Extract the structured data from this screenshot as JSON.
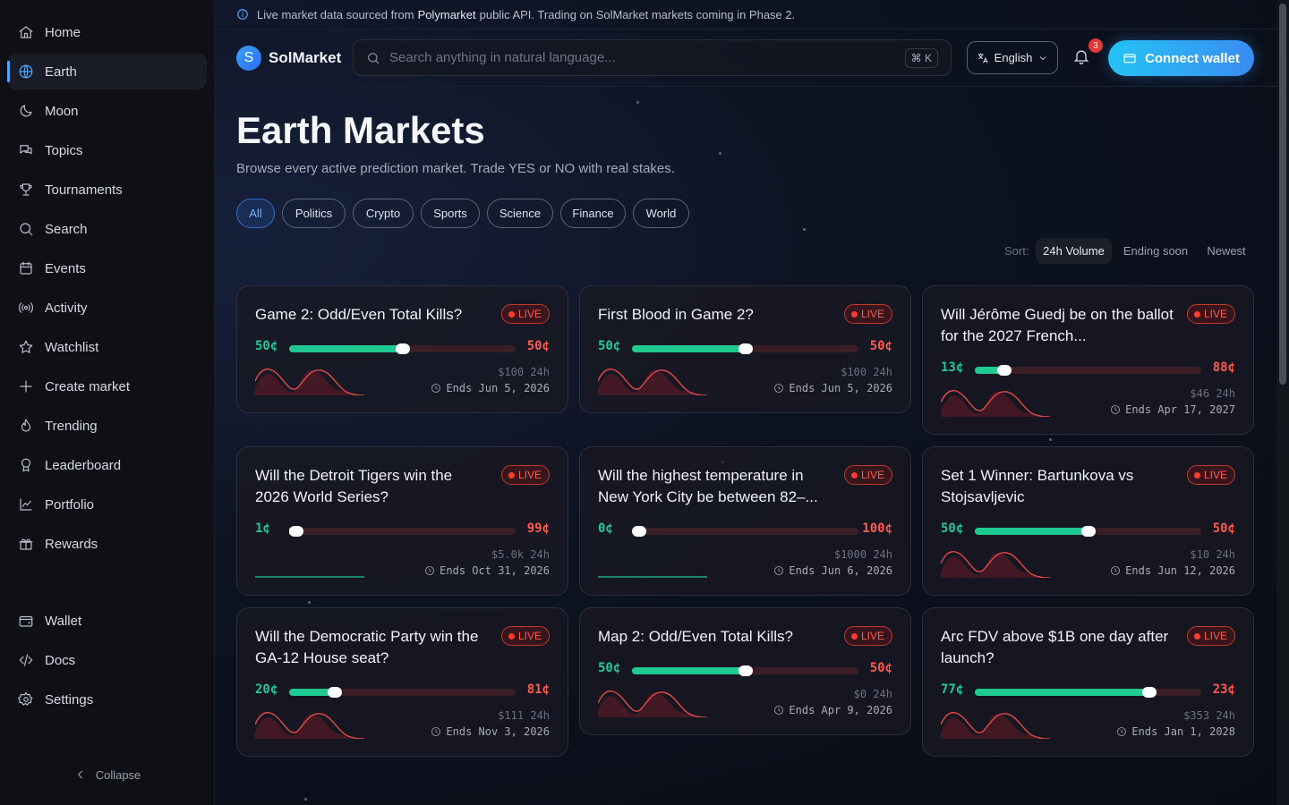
{
  "sidebar": {
    "items": [
      {
        "label": "Home",
        "icon": "home-icon"
      },
      {
        "label": "Earth",
        "icon": "globe-icon",
        "active": true
      },
      {
        "label": "Moon",
        "icon": "moon-icon"
      },
      {
        "label": "Topics",
        "icon": "chat-icon"
      },
      {
        "label": "Tournaments",
        "icon": "trophy-icon"
      },
      {
        "label": "Search",
        "icon": "search-icon"
      },
      {
        "label": "Events",
        "icon": "calendar-icon"
      },
      {
        "label": "Activity",
        "icon": "broadcast-icon"
      },
      {
        "label": "Watchlist",
        "icon": "star-icon"
      },
      {
        "label": "Create market",
        "icon": "plus-icon"
      },
      {
        "label": "Trending",
        "icon": "flame-icon"
      },
      {
        "label": "Leaderboard",
        "icon": "medal-icon"
      },
      {
        "label": "Portfolio",
        "icon": "chart-line-icon"
      },
      {
        "label": "Rewards",
        "icon": "gift-icon"
      }
    ],
    "bottom_items": [
      {
        "label": "Wallet",
        "icon": "wallet-icon"
      },
      {
        "label": "Docs",
        "icon": "code-icon"
      },
      {
        "label": "Settings",
        "icon": "gear-icon"
      }
    ],
    "collapse_label": "Collapse"
  },
  "banner": {
    "prefix": "Live market data sourced from",
    "source": "Polymarket",
    "suffix": "public API. Trading on SolMarket markets coming in Phase 2."
  },
  "header": {
    "logo_letter": "S",
    "brand": "SolMarket",
    "search_placeholder": "Search anything in natural language...",
    "search_shortcut": "⌘ K",
    "language": "English",
    "notification_count": "3",
    "connect_label": "Connect wallet"
  },
  "page": {
    "title": "Earth Markets",
    "subtitle": "Browse every active prediction market. Trade YES or NO with real stakes."
  },
  "filters": [
    "All",
    "Politics",
    "Crypto",
    "Sports",
    "Science",
    "Finance",
    "World"
  ],
  "active_filter": "All",
  "sort": {
    "label": "Sort:",
    "options": [
      "24h Volume",
      "Ending soon",
      "Newest"
    ],
    "active": "24h Volume"
  },
  "colors": {
    "accent": "#4aa8ff",
    "yes": "#22c99a",
    "no": "#ff5a4f",
    "live": "#ff3b30"
  },
  "markets": [
    {
      "title": "Game 2: Odd/Even Total Kills?",
      "badge": "LIVE",
      "yes": "50¢",
      "no": "50¢",
      "yes_fraction": 0.5,
      "volume": "$100 24h",
      "ends": "Ends Jun 5, 2026",
      "trend": "red"
    },
    {
      "title": "First Blood in Game 2?",
      "badge": "LIVE",
      "yes": "50¢",
      "no": "50¢",
      "yes_fraction": 0.5,
      "volume": "$100 24h",
      "ends": "Ends Jun 5, 2026",
      "trend": "red"
    },
    {
      "title": "Will Jérôme Guedj be on the ballot for the 2027 French...",
      "badge": "LIVE",
      "yes": "13¢",
      "no": "88¢",
      "yes_fraction": 0.13,
      "volume": "$46 24h",
      "ends": "Ends Apr 17, 2027",
      "trend": "red"
    },
    {
      "title": "Will the Detroit Tigers win the 2026 World Series?",
      "badge": "LIVE",
      "yes": "1¢",
      "no": "99¢",
      "yes_fraction": 0.01,
      "volume": "$5.0k 24h",
      "ends": "Ends Oct 31, 2026",
      "trend": "flat"
    },
    {
      "title": "Will the highest temperature in New York City be between 82–...",
      "badge": "LIVE",
      "yes": "0¢",
      "no": "100¢",
      "yes_fraction": 0.0,
      "volume": "$1000 24h",
      "ends": "Ends Jun 6, 2026",
      "trend": "flat"
    },
    {
      "title": "Set 1 Winner: Bartunkova vs Stojsavljevic",
      "badge": "LIVE",
      "yes": "50¢",
      "no": "50¢",
      "yes_fraction": 0.5,
      "volume": "$10 24h",
      "ends": "Ends Jun 12, 2026",
      "trend": "red"
    },
    {
      "title": "Will the Democratic Party win the GA-12 House seat?",
      "badge": "LIVE",
      "yes": "20¢",
      "no": "81¢",
      "yes_fraction": 0.2,
      "volume": "$111 24h",
      "ends": "Ends Nov 3, 2026",
      "trend": "red"
    },
    {
      "title": "Map 2: Odd/Even Total Kills?",
      "badge": "LIVE",
      "yes": "50¢",
      "no": "50¢",
      "yes_fraction": 0.5,
      "volume": "$0 24h",
      "ends": "Ends Apr 9, 2026",
      "trend": "red"
    },
    {
      "title": "Arc FDV above $1B one day after launch?",
      "badge": "LIVE",
      "yes": "77¢",
      "no": "23¢",
      "yes_fraction": 0.77,
      "volume": "$353 24h",
      "ends": "Ends Jan 1, 2028",
      "trend": "red"
    }
  ]
}
